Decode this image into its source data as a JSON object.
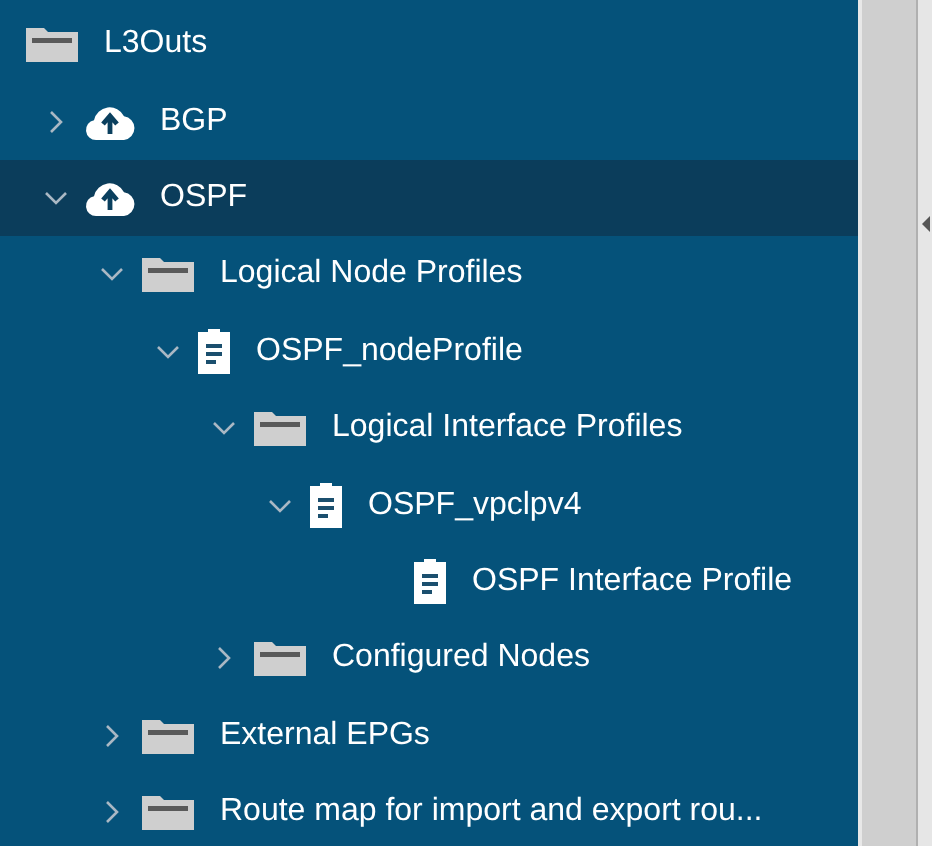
{
  "tree": [
    {
      "label": "L3Outs",
      "kind": "folder",
      "selected": false,
      "children": [
        {
          "label": "BGP",
          "kind": "cloud",
          "expanded": false,
          "selected": false
        },
        {
          "label": "OSPF",
          "kind": "cloud",
          "expanded": true,
          "selected": true,
          "children": [
            {
              "label": "Logical Node Profiles",
              "kind": "folder",
              "expanded": true,
              "selected": false,
              "children": [
                {
                  "label": "OSPF_nodeProfile",
                  "kind": "doc",
                  "expanded": true,
                  "selected": false,
                  "children": [
                    {
                      "label": "Logical Interface Profiles",
                      "kind": "folder",
                      "expanded": true,
                      "selected": false,
                      "children": [
                        {
                          "label": "OSPF_vpclpv4",
                          "kind": "doc",
                          "expanded": true,
                          "selected": false,
                          "children": [
                            {
                              "label": "OSPF Interface Profile",
                              "kind": "doc",
                              "selected": false
                            }
                          ]
                        }
                      ]
                    },
                    {
                      "label": "Configured Nodes",
                      "kind": "folder",
                      "expanded": false,
                      "selected": false
                    }
                  ]
                }
              ]
            },
            {
              "label": "External EPGs",
              "kind": "folder",
              "expanded": false,
              "selected": false
            },
            {
              "label": "Route map for import and export rou...",
              "kind": "folder",
              "expanded": false,
              "selected": false
            }
          ]
        }
      ]
    }
  ]
}
